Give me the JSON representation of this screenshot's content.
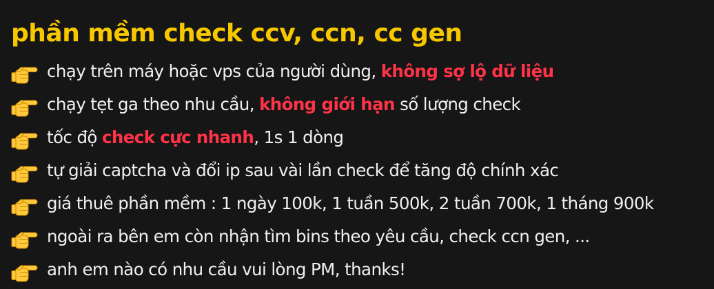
{
  "title": "phần mềm check ccv, ccn, cc gen",
  "bullet_icon": "backhand-index-pointing-right-icon",
  "colors": {
    "background": "#161616",
    "title": "#f7c800",
    "text": "#f0f0f0",
    "highlight": "#ff3347",
    "icon": "#ffc83d"
  },
  "items": [
    {
      "before": "chạy trên máy hoặc vps của người dùng, ",
      "highlight": "không sợ lộ dữ liệu",
      "after": ""
    },
    {
      "before": "chạy tẹt ga theo nhu cầu, ",
      "highlight": "không giới hạn",
      "after": " số lượng check"
    },
    {
      "before": "tốc độ ",
      "highlight": "check cực nhanh",
      "after": ", 1s 1 dòng"
    },
    {
      "before": "tự giải captcha và đổi ip sau vài lần check để tăng độ chính xác",
      "highlight": "",
      "after": ""
    },
    {
      "before": "giá thuê phần mềm : 1 ngày 100k, 1 tuần 500k, 2 tuần 700k, 1 tháng 900k",
      "highlight": "",
      "after": ""
    },
    {
      "before": "ngoài ra bên em còn nhận tìm bins theo yêu cầu, check ccn gen, ...",
      "highlight": "",
      "after": ""
    },
    {
      "before": "anh em nào có nhu cầu vui lòng PM, thanks!",
      "highlight": "",
      "after": ""
    }
  ]
}
